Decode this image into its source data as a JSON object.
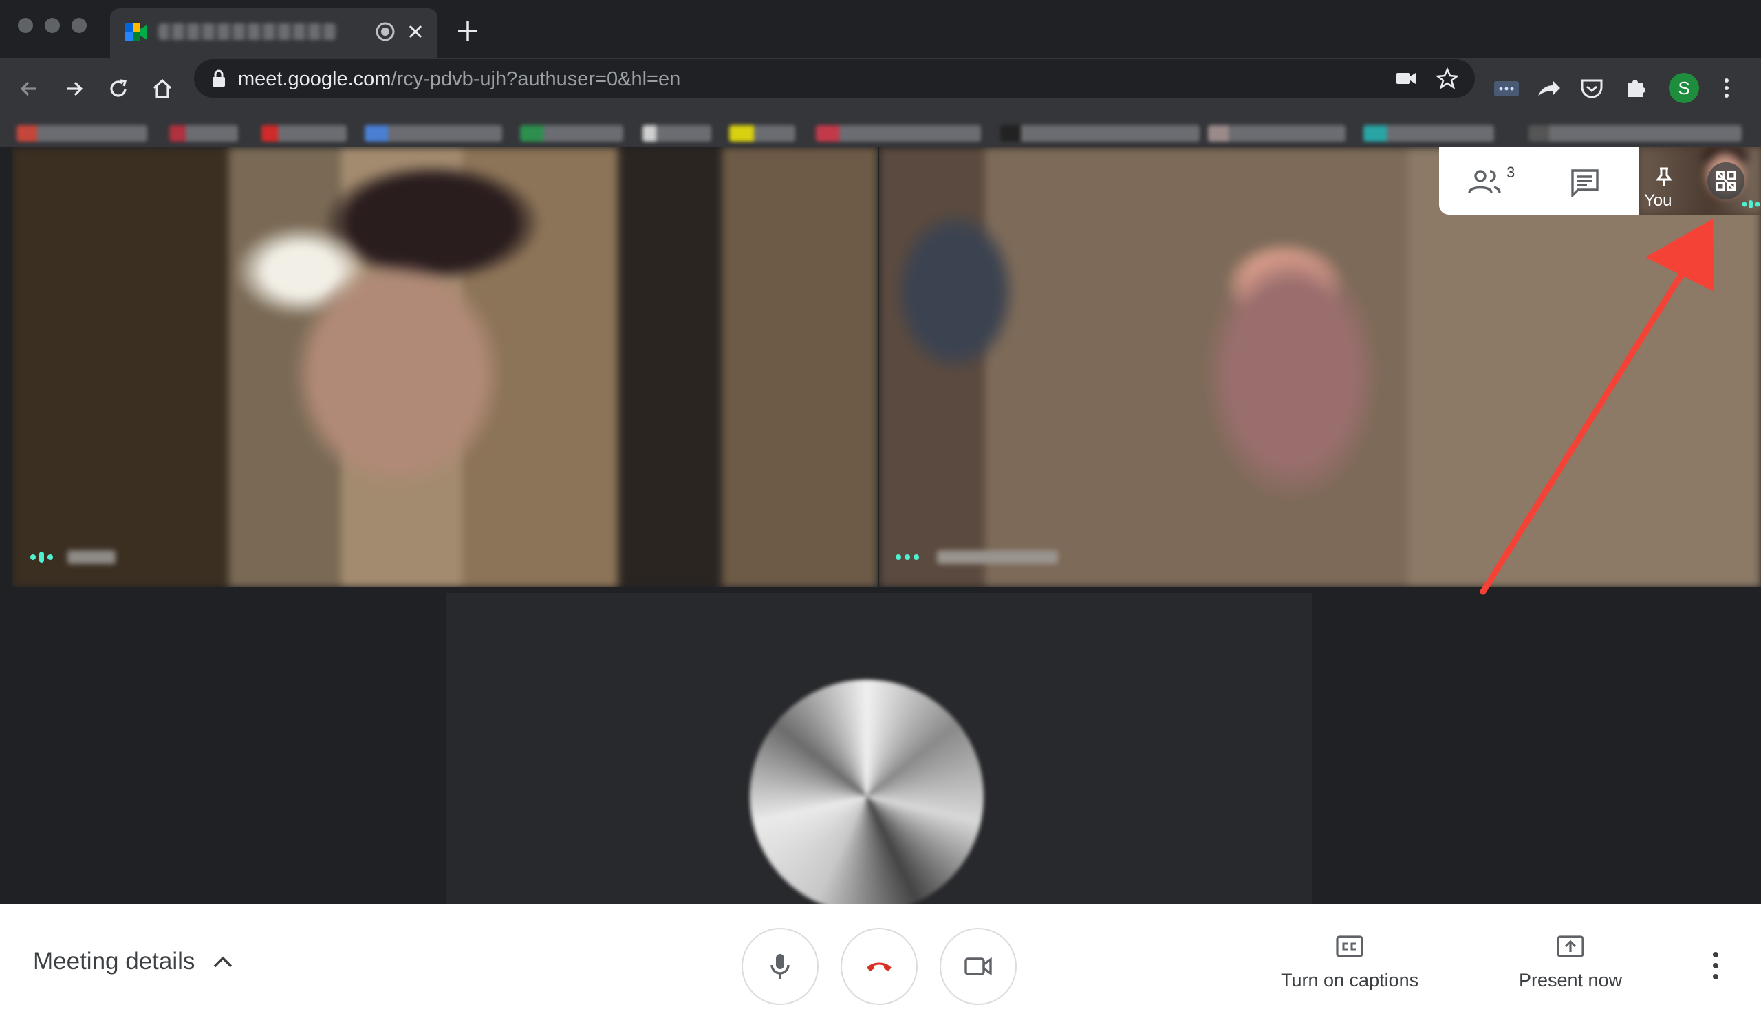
{
  "browser": {
    "url_host": "meet.google.com",
    "url_path": "/rcy-pdvb-ujh?authuser=0&hl=en",
    "profile_initial": "S",
    "accent_profile": "#1e8e3e"
  },
  "meeting": {
    "participant_count": "3",
    "self_label": "You"
  },
  "controls": {
    "meeting_details_label": "Meeting details",
    "captions_label": "Turn on captions",
    "present_label": "Present now",
    "end_call_color": "#d93025"
  }
}
